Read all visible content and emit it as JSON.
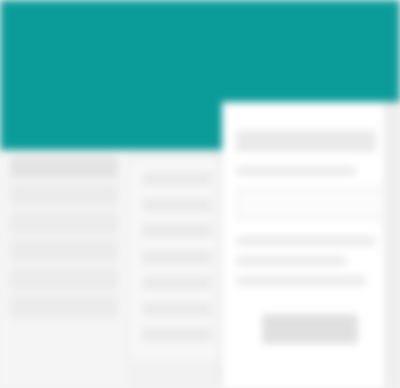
{
  "app": {
    "title": ""
  },
  "colors": {
    "header": "#0b9c9a",
    "background": "#f2f2f2",
    "dialog": "#ffffff"
  },
  "sidebar": {
    "items": [
      {
        "label": ""
      },
      {
        "label": ""
      },
      {
        "label": ""
      },
      {
        "label": ""
      },
      {
        "label": ""
      },
      {
        "label": ""
      }
    ]
  },
  "dialog": {
    "title": "",
    "button_label": ""
  }
}
